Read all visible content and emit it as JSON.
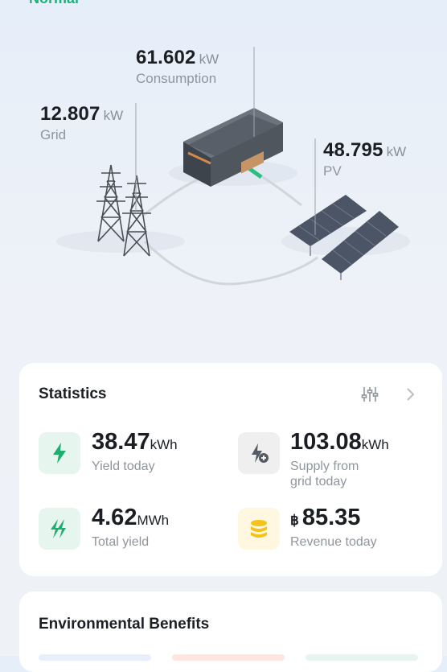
{
  "system_status": "Normal",
  "flow": {
    "consumption": {
      "value": "61.602",
      "unit": "kW",
      "label": "Consumption"
    },
    "grid": {
      "value": "12.807",
      "unit": "kW",
      "label": "Grid"
    },
    "pv": {
      "value": "48.795",
      "unit": "kW",
      "label": "PV"
    }
  },
  "statistics": {
    "title": "Statistics",
    "items": [
      {
        "value": "38.47",
        "unit": "kWh",
        "label": "Yield today",
        "icon": "lightning-icon"
      },
      {
        "value": "103.08",
        "unit": "kWh",
        "label": "Supply from grid today",
        "icon": "grid-supply-icon"
      },
      {
        "value": "4.62",
        "unit": "MWh",
        "label": "Total yield",
        "icon": "double-lightning-icon"
      },
      {
        "currency": "฿",
        "value": "85.35",
        "label": "Revenue today",
        "icon": "coins-icon"
      }
    ]
  },
  "environment": {
    "title": "Environmental Benefits"
  },
  "colors": {
    "accent_green": "#19b37a",
    "coin_yellow": "#f5c21b",
    "muted_text": "#8f959d"
  }
}
